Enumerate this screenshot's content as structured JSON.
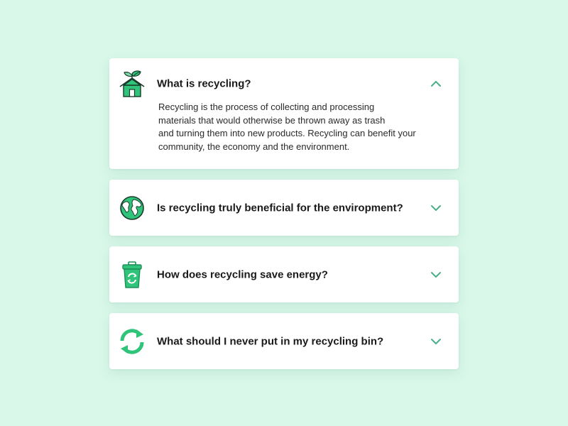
{
  "colors": {
    "background": "#d9f8ea",
    "accent": "#2fc47a",
    "accent_dark": "#1e8f58",
    "chevron": "#4caf89"
  },
  "faq": {
    "items": [
      {
        "icon": "eco-house-icon",
        "question": "What is recycling?",
        "expanded": true,
        "answer_lines": [
          "Recycling is the process of collecting and processing",
          "materials that would otherwise be thrown away as trash",
          "and turning them into new products. Recycling can benefit your",
          "community, the economy and the environment."
        ]
      },
      {
        "icon": "globe-icon",
        "question": "Is recycling truly beneficial for the enviropment?",
        "expanded": false
      },
      {
        "icon": "recycling-bin-icon",
        "question": "How does recycling save energy?",
        "expanded": false
      },
      {
        "icon": "recycle-arrows-icon",
        "question": "What should I never put in my recycling bin?",
        "expanded": false
      }
    ]
  }
}
